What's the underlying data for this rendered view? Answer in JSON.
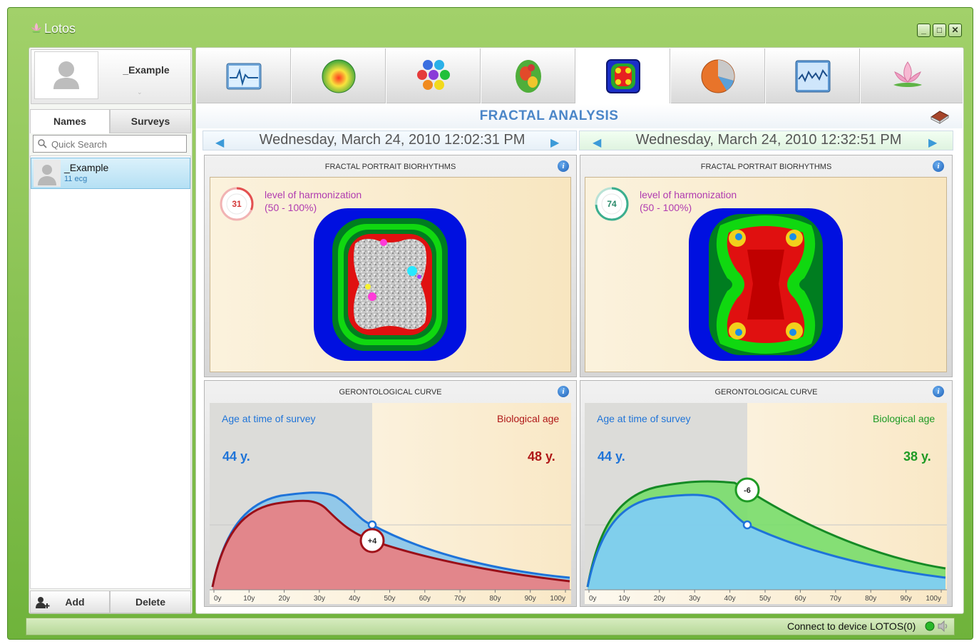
{
  "app": {
    "title": "Lotos"
  },
  "window_controls": {
    "minimize": "_",
    "maximize": "□",
    "close": "✕"
  },
  "profile": {
    "name": "_Example"
  },
  "left_tabs": [
    "Names",
    "Surveys"
  ],
  "search": {
    "placeholder": "Quick Search"
  },
  "list": {
    "items": [
      {
        "name": "_Example",
        "sub": "11 ecg"
      }
    ]
  },
  "bottom_buttons": {
    "add": "Add",
    "delete": "Delete"
  },
  "toolbar": {
    "icons": [
      "ecg-icon",
      "energy-ball-icon",
      "chakra-hexagons-icon",
      "brain-map-icon",
      "fractal-icon",
      "pie-chart-icon",
      "spectrum-chart-icon",
      "lotus-icon"
    ],
    "active_index": 4
  },
  "section": {
    "title": "FRACTAL ANALYSIS"
  },
  "surveys": [
    {
      "date": "Wednesday, March 24, 2010 12:02:31 PM",
      "fractal": {
        "title": "FRACTAL PORTRAIT BIORHYTHMS",
        "level": "31",
        "level_value": 31,
        "level_label": "level of harmonization",
        "level_range": "(50 - 100%)",
        "ring_color": "#e35050"
      },
      "curve": {
        "title": "GERONTOLOGICAL CURVE",
        "age_label": "Age at time of survey",
        "age_value": "44 y.",
        "bio_label": "Biological age",
        "bio_value": "48 y.",
        "diff": "+4",
        "bio_color": "#b01818"
      }
    },
    {
      "date": "Wednesday, March 24, 2010 12:32:51 PM",
      "fractal": {
        "title": "FRACTAL PORTRAIT BIORHYTHMS",
        "level": "74",
        "level_value": 74,
        "level_label": "level of harmonization",
        "level_range": "(50 - 100%)",
        "ring_color": "#3cae8e"
      },
      "curve": {
        "title": "GERONTOLOGICAL CURVE",
        "age_label": "Age at time of survey",
        "age_value": "44 y.",
        "bio_label": "Biological age",
        "bio_value": "38 y.",
        "diff": "-6",
        "bio_color": "#1e9a24"
      }
    }
  ],
  "axis_ticks": [
    "0y",
    "10y",
    "20y",
    "30y",
    "40y",
    "50y",
    "60y",
    "70y",
    "80y",
    "90y",
    "100y"
  ],
  "status": {
    "text": "Connect to device LOTOS(0)"
  }
}
